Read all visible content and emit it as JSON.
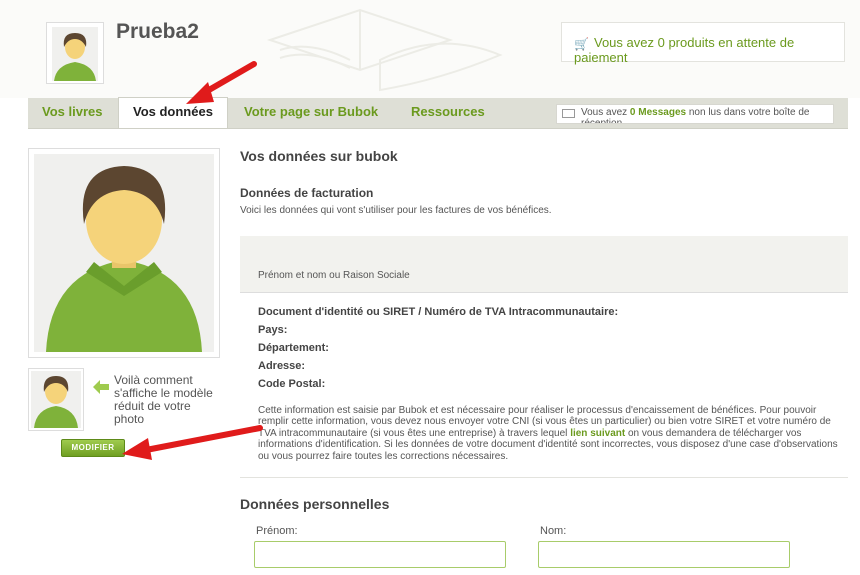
{
  "header": {
    "username": "Prueba2",
    "cart_text": "Vous avez 0 produits en attente de paiement"
  },
  "nav": {
    "tabs": [
      {
        "label": "Vos livres"
      },
      {
        "label": "Vos données"
      },
      {
        "label": "Votre page sur Bubok"
      },
      {
        "label": "Ressources"
      }
    ],
    "messages": {
      "prefix": "Vous avez ",
      "count": "0",
      "link": "Messages",
      "suffix": " non lus dans votre boîte de réception"
    }
  },
  "sidebar": {
    "thumb_caption": "Voilà comment s'affiche le modèle réduit de votre photo",
    "modify_label": "MODIFIER"
  },
  "main": {
    "title": "Vos données sur bubok",
    "billing_title": "Données de facturation",
    "billing_desc": "Voici les données qui vont s'utiliser pour les factures de vos bénéfices.",
    "name_label": "Prénom et nom ou Raison Sociale",
    "fields": [
      "Document d'identité ou SIRET / Numéro de TVA Intracommunautaire:",
      "Pays:",
      "Département:",
      "Adresse:",
      "Code Postal:"
    ],
    "paragraph_before": "Cette information est saisie par Bubok et est nécessaire pour réaliser le processus d'encaissement de bénéfices. Pour pouvoir remplir cette information, vous devez nous envoyer votre CNI (si vous êtes un particulier) ou bien votre SIRET et votre numéro de TVA intracommunautaire (si vous êtes une entreprise) à travers lequel ",
    "paragraph_link": "lien suivant",
    "paragraph_after": " on vous demandera de télécharger vos informations d'identification. Si les données de votre document d'identité sont incorrectes, vous disposez d'une case d'observations ou vous pourrez faire toutes les corrections nécessaires.",
    "personal_title": "Données personnelles",
    "firstname_label": "Prénom:",
    "lastname_label": "Nom:",
    "firstname_value": "",
    "lastname_value": ""
  },
  "colors": {
    "accent_green": "#6b9a1e",
    "nav_bg": "#dedfd6",
    "annotation_red": "#e01b1b"
  }
}
